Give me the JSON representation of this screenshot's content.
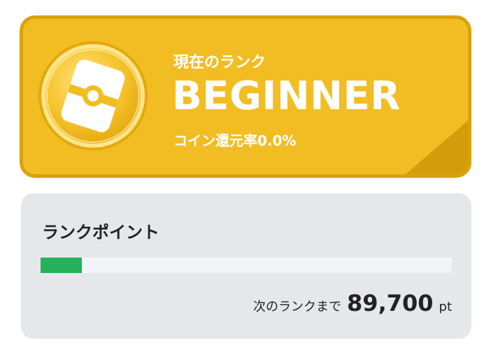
{
  "rank": {
    "caption": "現在のランク",
    "name": "BEGINNER",
    "coin_rate": "コイン還元率0.0%",
    "medal_icon": "rank-medal-icon",
    "color_primary": "#f2bd22",
    "color_border": "#d9a20c"
  },
  "points": {
    "title": "ランクポイント",
    "progress_fraction": 0.1,
    "progress_color": "#23b25a",
    "next_label": "次のランクまで",
    "next_value": "89,700",
    "unit": "pt"
  }
}
